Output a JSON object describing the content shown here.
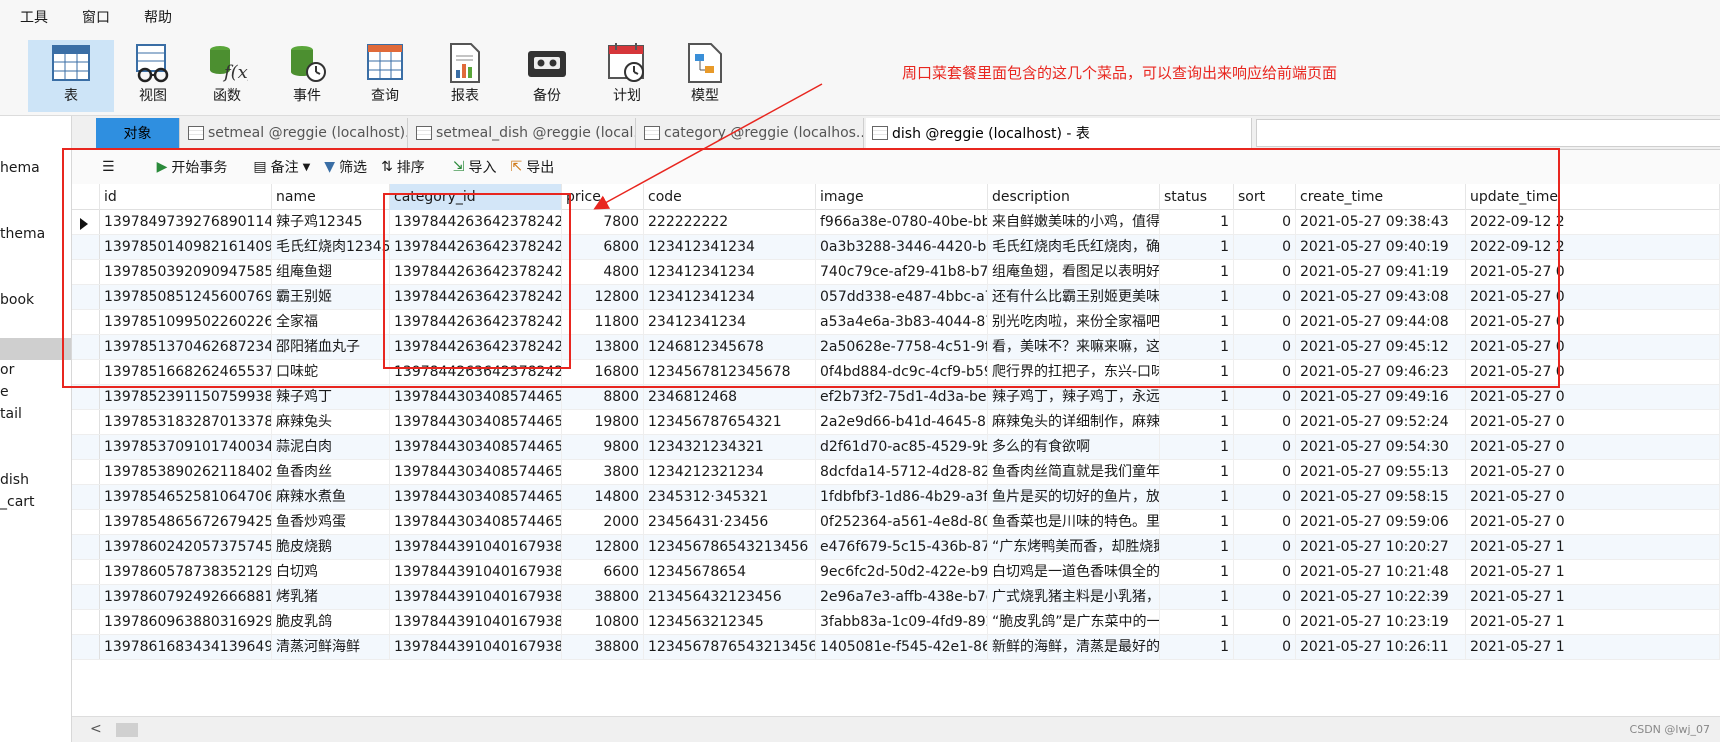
{
  "menu": [
    "工具",
    "窗口",
    "帮助"
  ],
  "toolbar": {
    "buttons": [
      {
        "label": "表",
        "icon": "table-icon"
      },
      {
        "label": "视图",
        "icon": "view-icon"
      },
      {
        "label": "函数",
        "icon": "function-icon"
      },
      {
        "label": "事件",
        "icon": "event-icon"
      },
      {
        "label": "查询",
        "icon": "query-icon"
      },
      {
        "label": "报表",
        "icon": "report-icon"
      },
      {
        "label": "备份",
        "icon": "backup-icon"
      },
      {
        "label": "计划",
        "icon": "schedule-icon"
      },
      {
        "label": "模型",
        "icon": "model-icon"
      }
    ]
  },
  "annotation": "周口菜套餐里面包含的这几个菜品，可以查询出来响应给前端页面",
  "left_panel": [
    "hema",
    "thema",
    "book",
    "",
    "or",
    "e",
    "tail",
    "dish",
    "_cart"
  ],
  "tabs": {
    "objects": "对象",
    "items": [
      "setmeal @reggie (localhost)...",
      "setmeal_dish @reggie (local...",
      "category @reggie (localhos...",
      "dish @reggie (localhost) - 表"
    ]
  },
  "grid_toolbar": {
    "menu_glyph": "☰",
    "begin_tx": "开始事务",
    "memo": "备注",
    "filter": "筛选",
    "sort": "排序",
    "import": "导入",
    "export": "导出"
  },
  "columns": [
    "id",
    "name",
    "category_id",
    "price",
    "code",
    "image",
    "description",
    "status",
    "sort",
    "create_time",
    "update_time"
  ],
  "rows": [
    [
      "1397849739276890114",
      "辣子鸡12345",
      "1397844263642378242",
      "7800",
      "222222222",
      "f966a38e-0780-40be-bb5",
      "来自鲜嫩美味的小鸡，值得一",
      "1",
      "0",
      "2021-05-27 09:38:43",
      "2022-09-12 2"
    ],
    [
      "1397850140982161409",
      "毛氏红烧肉12345",
      "1397844263642378242",
      "6800",
      "123412341234",
      "0a3b3288-3446-4420-bbf",
      "毛氏红烧肉毛氏红烧肉，确实",
      "1",
      "0",
      "2021-05-27 09:40:19",
      "2022-09-12 2"
    ],
    [
      "1397850392090947585",
      "组庵鱼翅",
      "1397844263642378242",
      "4800",
      "123412341234",
      "740c79ce-af29-41b8-b78",
      "组庵鱼翅，看图足以表明好吃",
      "1",
      "0",
      "2021-05-27 09:41:19",
      "2021-05-27 0"
    ],
    [
      "1397850851245600769",
      "霸王别姬",
      "1397844263642378242",
      "12800",
      "123412341234",
      "057dd338-e487-4bbc-a74",
      "还有什么比霸王别姬更美味的",
      "1",
      "0",
      "2021-05-27 09:43:08",
      "2021-05-27 0"
    ],
    [
      "1397851099502260226",
      "全家福",
      "1397844263642378242",
      "11800",
      "23412341234",
      "a53a4e6a-3b83-4044-87f",
      "别光吃肉啦，来份全家福吧，",
      "1",
      "0",
      "2021-05-27 09:44:08",
      "2021-05-27 0"
    ],
    [
      "1397851370462687234",
      "邵阳猪血丸子",
      "1397844263642378242",
      "13800",
      "1246812345678",
      "2a50628e-7758-4c51-9fb",
      "看，美味不？来嘛来嘛，这才",
      "1",
      "0",
      "2021-05-27 09:45:12",
      "2021-05-27 0"
    ],
    [
      "1397851668262465537",
      "口味蛇",
      "1397844263642378242",
      "16800",
      "1234567812345678",
      "0f4bd884-dc9c-4cf9-b59e",
      "爬行界的扛把子，东兴-口味",
      "1",
      "0",
      "2021-05-27 09:46:23",
      "2021-05-27 0"
    ],
    [
      "1397852391150759938",
      "辣子鸡丁",
      "1397844303408574465",
      "8800",
      "2346812468",
      "ef2b73f2-75d1-4d3a-bee",
      "辣子鸡丁，辣子鸡丁，永远的",
      "1",
      "0",
      "2021-05-27 09:49:16",
      "2021-05-27 0"
    ],
    [
      "1397853183287013378",
      "麻辣兔头",
      "1397844303408574465",
      "19800",
      "123456787654321",
      "2a2e9d66-b41d-4645-87b",
      "麻辣兔头的详细制作，麻辣鲜",
      "1",
      "0",
      "2021-05-27 09:52:24",
      "2021-05-27 0"
    ],
    [
      "1397853709101740034",
      "蒜泥白肉",
      "1397844303408574465",
      "9800",
      "1234321234321",
      "d2f61d70-ac85-4529-9b7",
      "多么的有食欲啊",
      "1",
      "0",
      "2021-05-27 09:54:30",
      "2021-05-27 0"
    ],
    [
      "1397853890262118402",
      "鱼香肉丝",
      "1397844303408574465",
      "3800",
      "1234212321234",
      "8dcfda14-5712-4d28-82f",
      "鱼香肉丝简直就是我们童年回",
      "1",
      "0",
      "2021-05-27 09:55:13",
      "2021-05-27 0"
    ],
    [
      "1397854652581064706",
      "麻辣水煮鱼",
      "1397844303408574465",
      "14800",
      "2345312·345321",
      "1fdbfbf3-1d86-4b29-a3fc",
      "鱼片是买的切好的鱼片，放几",
      "1",
      "0",
      "2021-05-27 09:58:15",
      "2021-05-27 0"
    ],
    [
      "1397854865672679425",
      "鱼香炒鸡蛋",
      "1397844303408574465",
      "2000",
      "23456431·23456",
      "0f252364-a561-4e8d-806",
      "鱼香菜也是川味的特色。里面",
      "1",
      "0",
      "2021-05-27 09:59:06",
      "2021-05-27 0"
    ],
    [
      "1397860242057375745",
      "脆皮烧鹅",
      "1397844391040167938",
      "12800",
      "123456786543213456",
      "e476f679-5c15-436b-87fa",
      "“广东烤鸭美而香，却胜烧鹅",
      "1",
      "0",
      "2021-05-27 10:20:27",
      "2021-05-27 1"
    ],
    [
      "1397860578738352129",
      "白切鸡",
      "1397844391040167938",
      "6600",
      "12345678654",
      "9ec6fc2d-50d2-422e-b95",
      "白切鸡是一道色香味俱全的特",
      "1",
      "0",
      "2021-05-27 10:21:48",
      "2021-05-27 1"
    ],
    [
      "1397860792492666881",
      "烤乳猪",
      "1397844391040167938",
      "38800",
      "213456432123456",
      "2e96a7e3-affb-438e-b7c3",
      "广式烧乳猪主料是小乳猪，辅",
      "1",
      "0",
      "2021-05-27 10:22:39",
      "2021-05-27 1"
    ],
    [
      "1397860963880316929",
      "脆皮乳鸽",
      "1397844391040167938",
      "10800",
      "1234563212345",
      "3fabb83a-1c09-4fd9-892b",
      "“脆皮乳鸽”是广东菜中的一道",
      "1",
      "0",
      "2021-05-27 10:23:19",
      "2021-05-27 1"
    ],
    [
      "1397861683434139649",
      "清蒸河鲜海鲜",
      "1397844391040167938",
      "38800",
      "1234567876543213456",
      "1405081e-f545-42e1-86a",
      "新鲜的海鲜，清蒸是最好的处",
      "1",
      "0",
      "2021-05-27 10:26:11",
      "2021-05-27 1"
    ]
  ],
  "watermark": "CSDN @lwj_07",
  "colors": {
    "accent": "#2f8fe0",
    "annotation": "#e8261f",
    "header_highlight": "#d3e6f8"
  }
}
